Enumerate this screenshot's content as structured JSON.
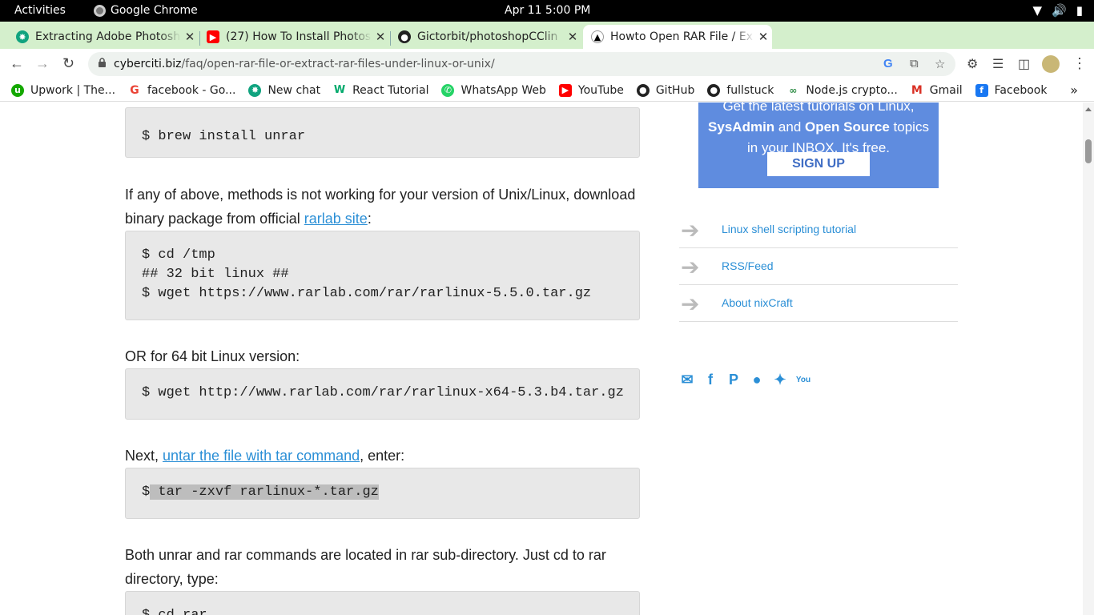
{
  "system_bar": {
    "activities": "Activities",
    "app_name": "Google Chrome",
    "clock": "Apr 11  5:00 PM"
  },
  "tabs": [
    {
      "title": "Extracting Adobe Photosh",
      "icon": "chatgpt-icon"
    },
    {
      "title": "(27) How To Install Photos",
      "icon": "youtube-icon"
    },
    {
      "title": "Gictorbit/photoshopCClin",
      "icon": "github-icon"
    },
    {
      "title": "Howto Open RAR File / Ex",
      "icon": "nixcraft-icon",
      "active": true
    }
  ],
  "omnibox": {
    "domain": "cyberciti.biz",
    "path": "/faq/open-rar-file-or-extract-rar-files-under-linux-or-unix/"
  },
  "bookmarks": [
    {
      "label": "Upwork | The...",
      "icon": "upwork-icon",
      "color": "#14a800"
    },
    {
      "label": "facebook - Go...",
      "icon": "google-icon",
      "color": "#ea4335"
    },
    {
      "label": "New chat",
      "icon": "chatgpt-icon",
      "color": "#10a37f"
    },
    {
      "label": "React Tutorial",
      "icon": "w3schools-icon",
      "color": "#04aa6d"
    },
    {
      "label": "WhatsApp Web",
      "icon": "whatsapp-icon",
      "color": "#25d366"
    },
    {
      "label": "YouTube",
      "icon": "youtube-icon",
      "color": "#ff0000"
    },
    {
      "label": "GitHub",
      "icon": "github-icon",
      "color": "#222222"
    },
    {
      "label": "fullstuck",
      "icon": "github-icon",
      "color": "#222222"
    },
    {
      "label": "Node.js crypto...",
      "icon": "geeksforgeeks-icon",
      "color": "#2f8d46"
    },
    {
      "label": "Gmail",
      "icon": "gmail-icon",
      "color": "#d93025"
    },
    {
      "label": "Facebook",
      "icon": "facebook-icon",
      "color": "#1877f2"
    }
  ],
  "article": {
    "code1": "$ brew install unrar",
    "para1_text": "If any of above, methods is not working for your version of Unix/Linux, download binary package from official ",
    "para1_link": "rarlab site",
    "para1_end": ":",
    "code2": [
      "$ cd /tmp",
      "## 32 bit linux ##",
      "$ wget https://www.rarlab.com/rar/rarlinux-5.5.0.tar.gz"
    ],
    "para2": "OR for 64 bit Linux version:",
    "code3": "$ wget http://www.rarlab.com/rar/rarlinux-x64-5.3.b4.tar.gz",
    "para3_start": "Next, ",
    "para3_link": "untar the file with tar command",
    "para3_end": ", enter:",
    "code4_prompt": "$",
    "code4_selected": " tar -zxvf rarlinux-*.tar.gz",
    "para4": "Both unrar and rar commands are located in rar sub-directory. Just cd to rar directory, type:",
    "code5": "$ cd rar"
  },
  "sidebar": {
    "promo_line1": "Get the latest tutorials on Linux,",
    "promo_line2a": "SysAdmin",
    "promo_line2b": " and ",
    "promo_line2c": "Open Source",
    "promo_line2d": " topics",
    "promo_line3": "in your INBOX. It's free.",
    "signup": "SIGN UP",
    "links": [
      "Linux shell scripting tutorial",
      "RSS/Feed",
      "About nixCraft"
    ],
    "social_icons": [
      "email-icon",
      "facebook-icon",
      "patreon-icon",
      "reddit-icon",
      "twitter-icon",
      "youtube-icon"
    ]
  }
}
